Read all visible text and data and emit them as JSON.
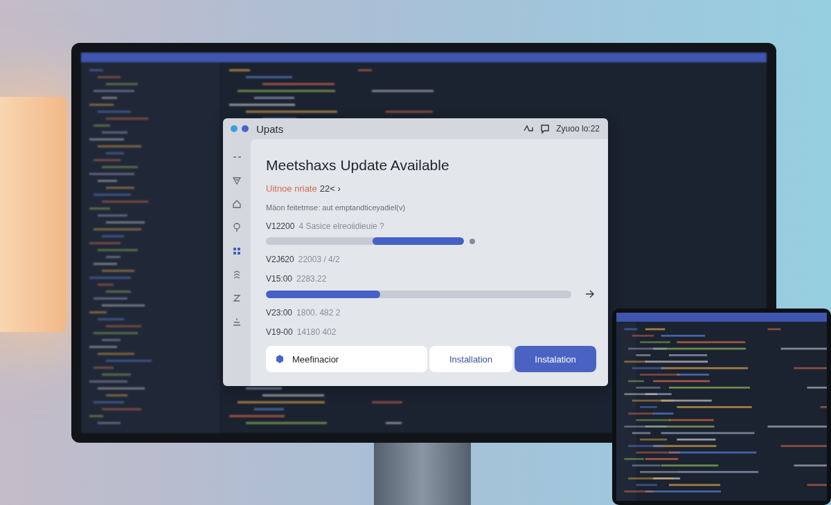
{
  "window": {
    "title": "Upats",
    "clock": "Zyuoo lo:22"
  },
  "sidebar": {
    "items": [
      {
        "kind": "minus",
        "selected": false
      },
      {
        "kind": "filter",
        "selected": false
      },
      {
        "kind": "home",
        "selected": false
      },
      {
        "kind": "bulb",
        "selected": false
      },
      {
        "kind": "grid",
        "selected": true
      },
      {
        "kind": "stack",
        "selected": false
      },
      {
        "kind": "zigzag",
        "selected": false
      },
      {
        "kind": "download",
        "selected": false
      }
    ]
  },
  "content": {
    "title": "Meetshaxs Update Available",
    "subtitle": {
      "label": "Uitnoe nriate",
      "value": "22< ›"
    },
    "description": "Mäon feitetmse: aut emptandticeyadiel(v)",
    "updates": [
      {
        "kind": "progress_reverse",
        "version": "V12200",
        "detail": "4 Sasice elreoiidieuie ?",
        "level": 0.46
      },
      {
        "kind": "text",
        "version": "V2J620",
        "detail": "22003 / 4/2"
      },
      {
        "kind": "progress",
        "version": "V15:00",
        "detail": "2283.22",
        "level": 0.375
      },
      {
        "kind": "text",
        "version": "V23:00",
        "detail": "1800. 482 2"
      },
      {
        "kind": "text",
        "version": "V19-00",
        "detail": "14180 402"
      }
    ]
  },
  "buttons": [
    {
      "kind": "option",
      "label": "Meefinacior"
    },
    {
      "kind": "secondary",
      "label": "Installation"
    },
    {
      "kind": "primary",
      "label": "Instalation"
    }
  ]
}
